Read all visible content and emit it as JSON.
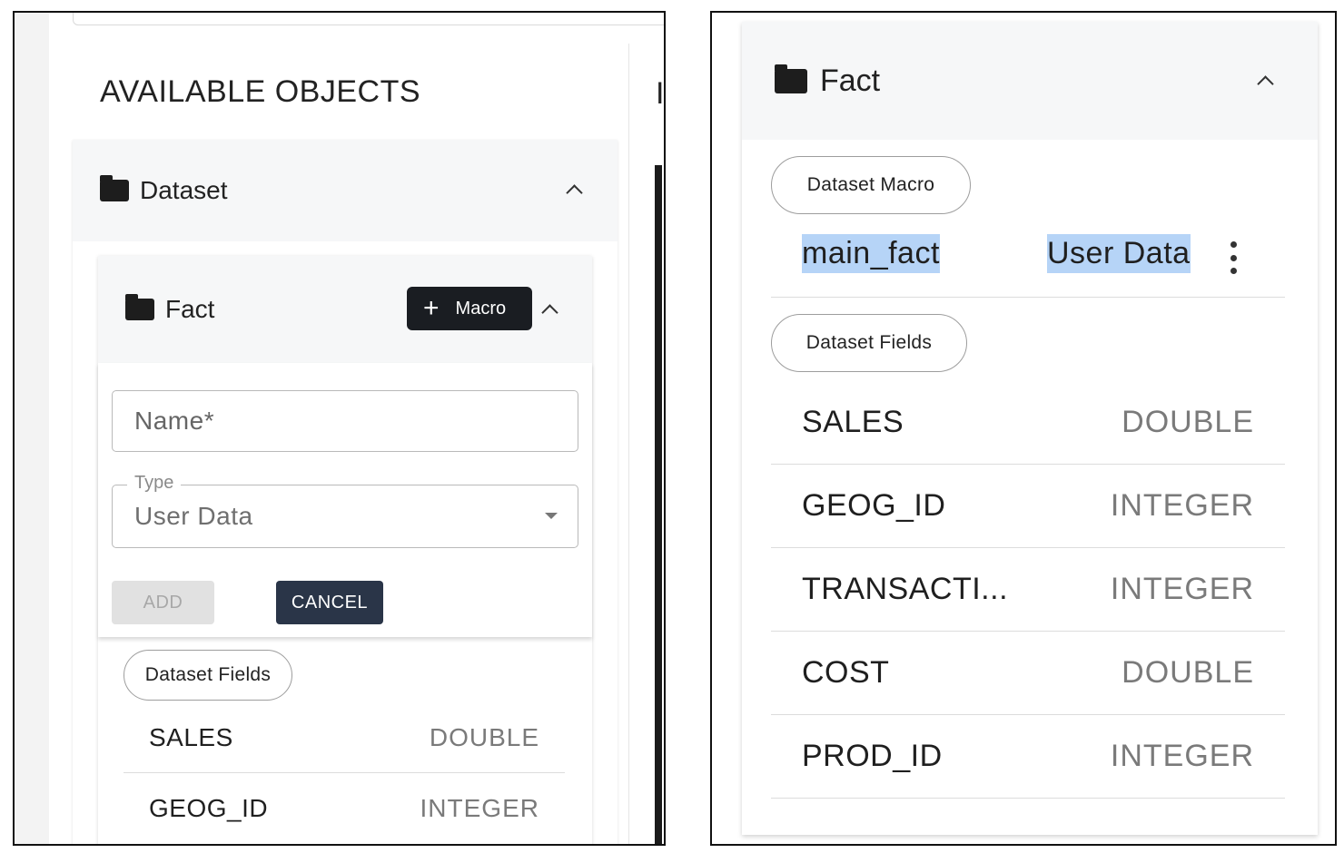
{
  "left_panel": {
    "section_title": "AVAILABLE OBJECTS",
    "dataset_label": "Dataset",
    "fact_label": "Fact",
    "macro_button": "Macro",
    "form": {
      "name_placeholder": "Name*",
      "type_label": "Type",
      "type_value": "User Data",
      "add_label": "ADD",
      "cancel_label": "CANCEL"
    },
    "fields_chip": "Dataset Fields",
    "fields": [
      {
        "name": "SALES",
        "type": "DOUBLE"
      },
      {
        "name": "GEOG_ID",
        "type": "INTEGER"
      }
    ],
    "cut_off_text": "I"
  },
  "right_panel": {
    "fact_label": "Fact",
    "macro_chip": "Dataset Macro",
    "macro_item": {
      "name": "main_fact",
      "type": "User Data"
    },
    "fields_chip": "Dataset Fields",
    "fields": [
      {
        "name": "SALES",
        "type": "DOUBLE"
      },
      {
        "name": "GEOG_ID",
        "type": "INTEGER"
      },
      {
        "name": "TRANSACTI...",
        "type": "INTEGER"
      },
      {
        "name": "COST",
        "type": "DOUBLE"
      },
      {
        "name": "PROD_ID",
        "type": "INTEGER"
      }
    ]
  },
  "colors": {
    "header_bg": "#f6f7f8",
    "macro_button_bg": "#1a1d22",
    "cancel_button_bg": "#2a3548",
    "highlight": "#b6d4f7"
  }
}
